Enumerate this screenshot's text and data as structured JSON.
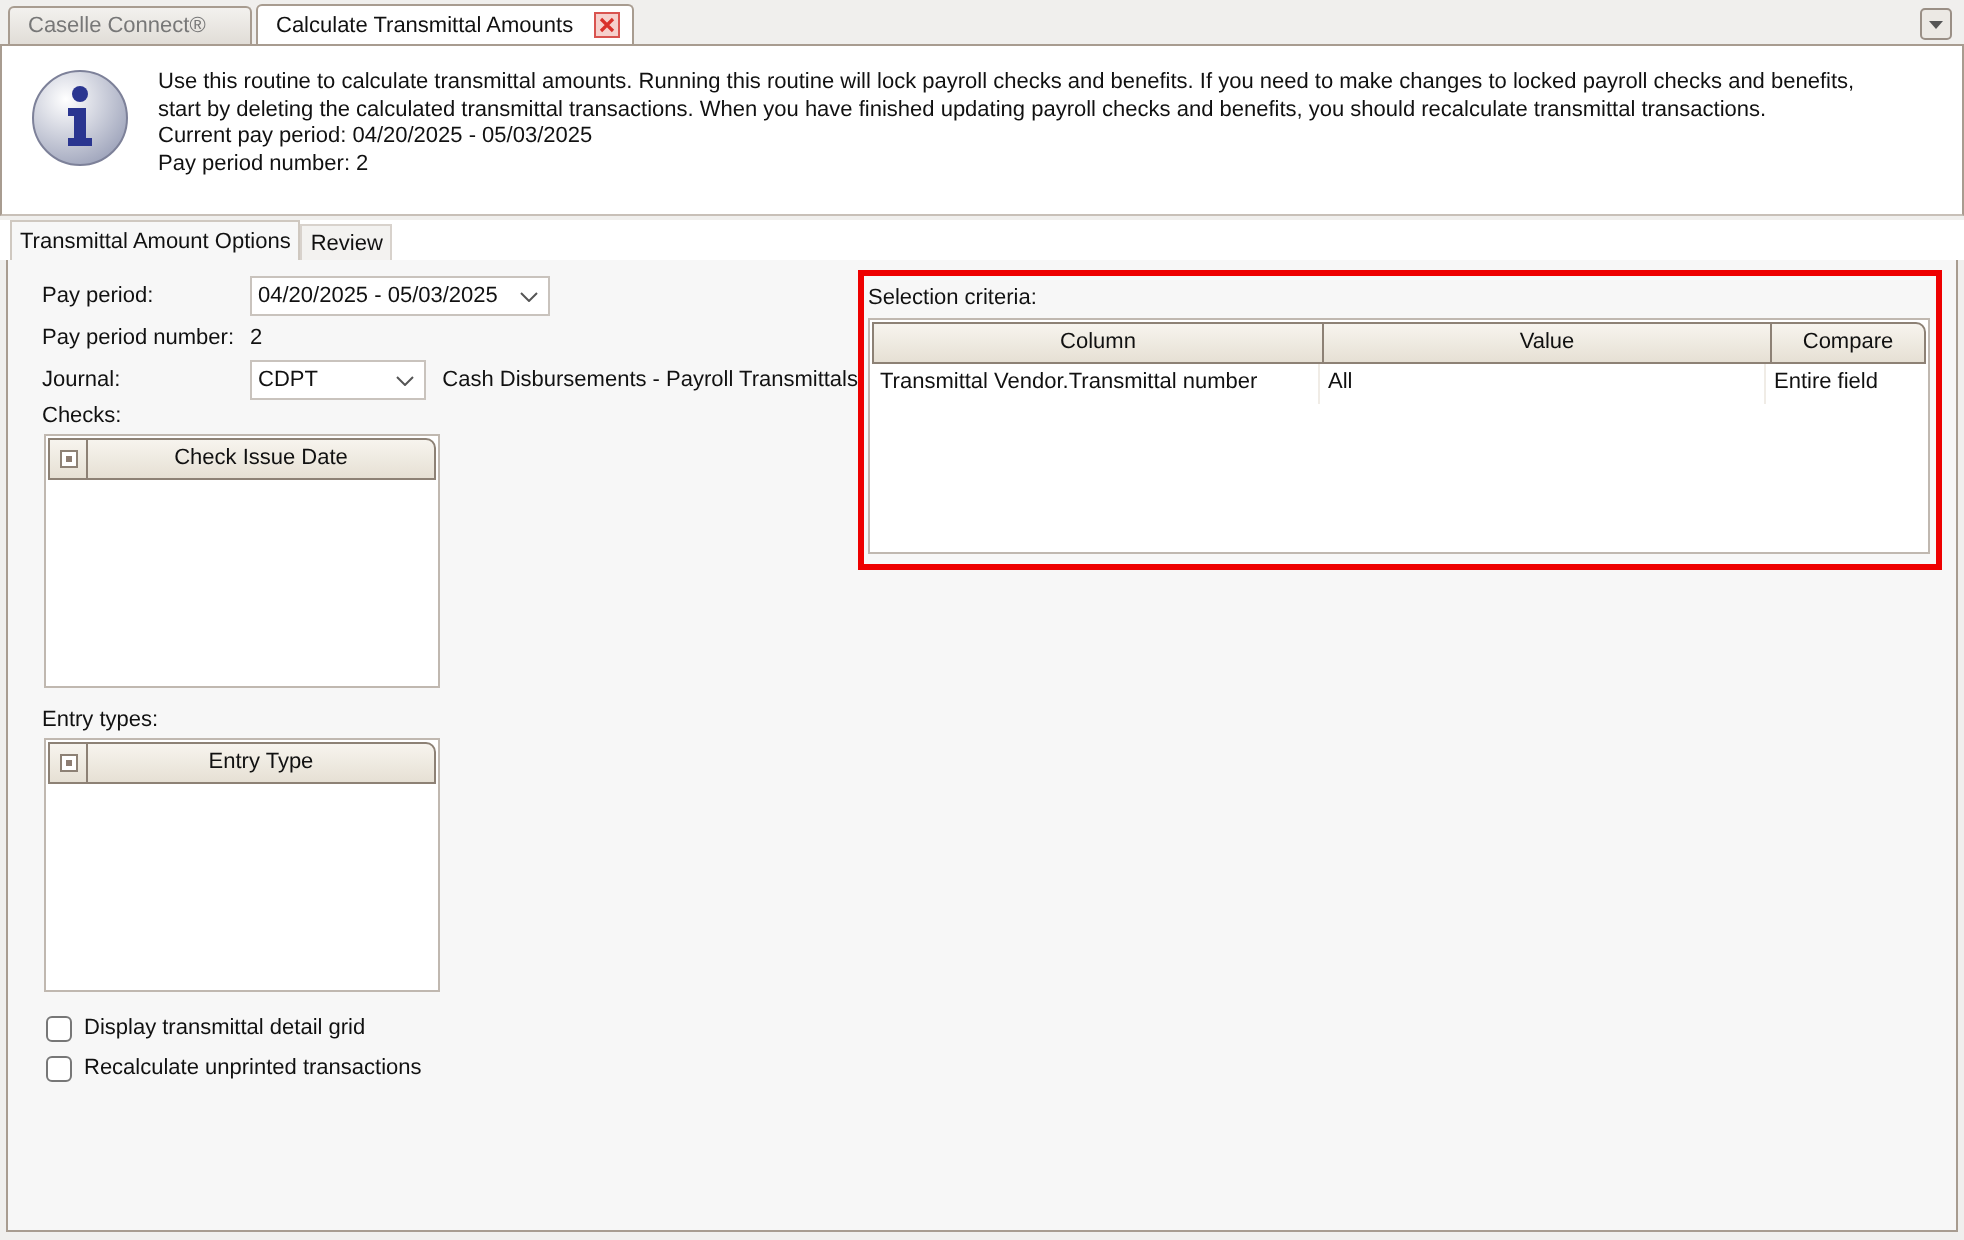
{
  "document_tabs": [
    {
      "label": "Caselle Connect®",
      "selected": false,
      "closable": false
    },
    {
      "label": "Calculate Transmittal Amounts",
      "selected": true,
      "closable": true
    }
  ],
  "info": {
    "description": "Use this routine to calculate transmittal amounts. Running this routine will lock payroll checks and benefits. If you need to make changes to locked payroll checks and benefits, start by deleting the calculated transmittal transactions. When you have finished updating payroll checks and benefits, you should recalculate transmittal transactions.",
    "current_pay_period": "Current pay period: 04/20/2025 - 05/03/2025",
    "pay_period_number": "Pay period number: 2"
  },
  "option_tabs": [
    {
      "label": "Transmittal Amount Options",
      "selected": true
    },
    {
      "label": "Review",
      "selected": false
    }
  ],
  "form": {
    "pay_period": {
      "label": "Pay period:",
      "value": "04/20/2025 - 05/03/2025"
    },
    "pay_period_number": {
      "label": "Pay period number:",
      "value": "2"
    },
    "journal": {
      "label": "Journal:",
      "value": "CDPT",
      "description": "Cash Disbursements - Payroll Transmittals"
    },
    "checks": {
      "label": "Checks:",
      "column": "Check Issue Date",
      "indeterminate": true
    },
    "entry_types": {
      "label": "Entry types:",
      "column": "Entry Type",
      "indeterminate": true
    },
    "options": [
      {
        "label": "Display transmittal detail grid",
        "checked": false
      },
      {
        "label": "Recalculate unprinted transactions",
        "checked": false
      }
    ]
  },
  "selection_criteria": {
    "label": "Selection criteria:",
    "highlighted": true,
    "columns": [
      "Column",
      "Value",
      "Compare"
    ],
    "rows": [
      [
        "Transmittal Vendor.Transmittal number",
        "All",
        "Entire field"
      ]
    ]
  }
}
